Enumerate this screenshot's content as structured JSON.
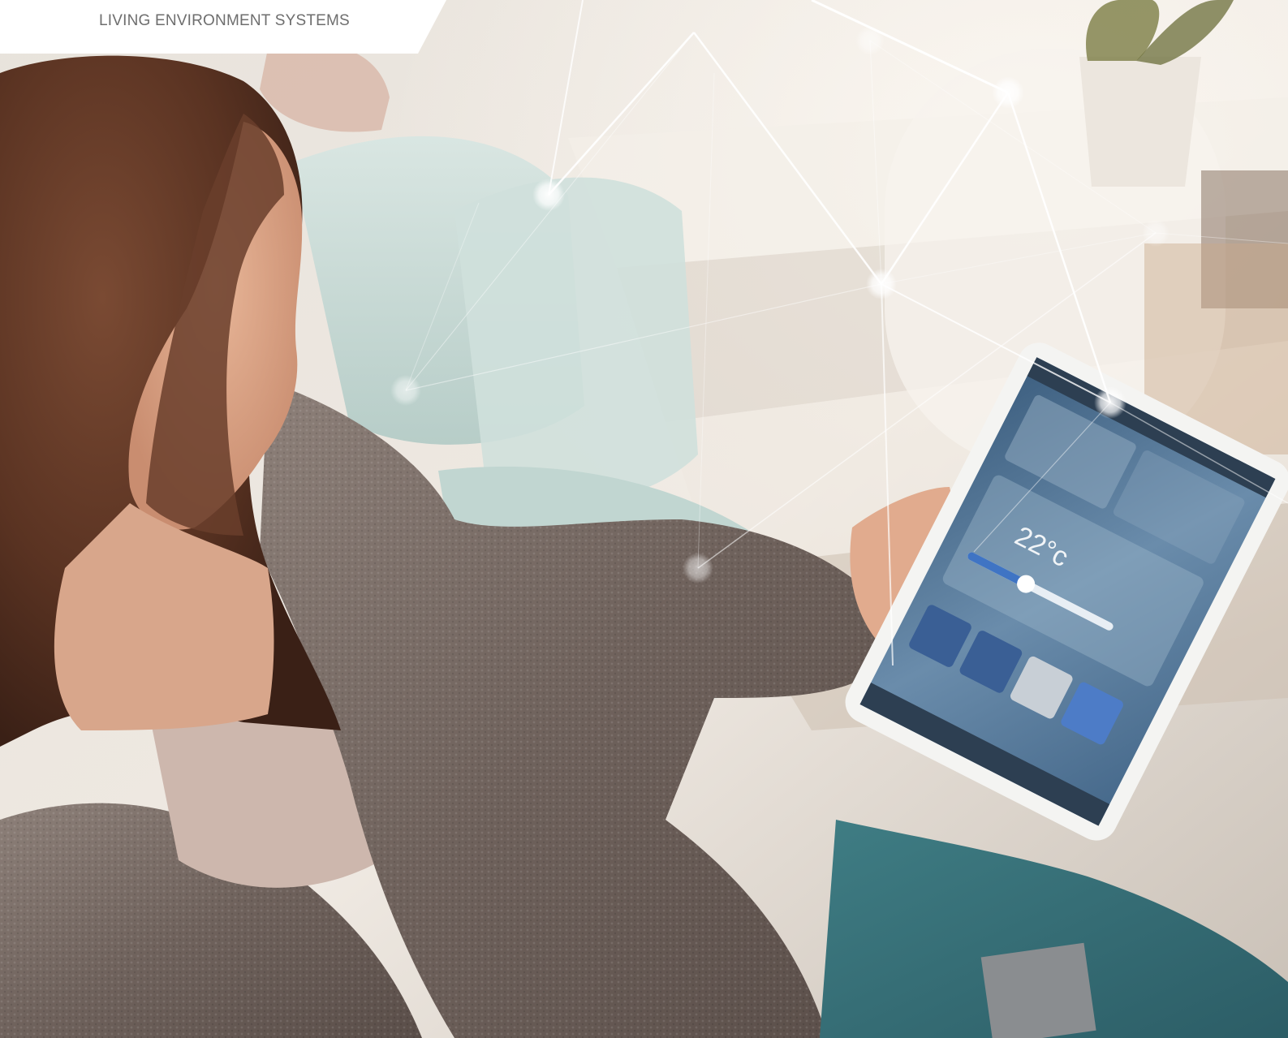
{
  "header": {
    "label": "LIVING ENVIRONMENT SYSTEMS"
  },
  "tablet": {
    "temperature": "22°c"
  },
  "colors": {
    "header_tab": "#ffffff",
    "header_text": "#6e6e6e",
    "network_line": "#ffffff",
    "tablet_screen": "#5d7f9e",
    "slider_blue": "#3f74c4"
  }
}
